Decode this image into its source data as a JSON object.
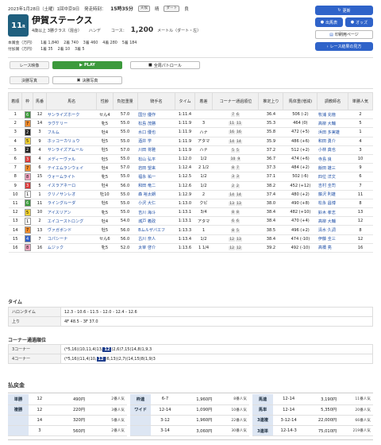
{
  "header": {
    "date": "2023年1月28日（土曜）1回中京9日",
    "start": "発走時刻：",
    "start_time": "15時35分",
    "tags": [
      "天候",
      "晴",
      "ダート",
      "良"
    ]
  },
  "race": {
    "num": "11",
    "r": "R",
    "name": "伊賀ステークス",
    "cond1": "4歳以上 3勝クラス（混合）",
    "cond2": "ハンデ",
    "course_label": "コース：",
    "distance": "1,200",
    "unit": "メートル（ダート・左）"
  },
  "prize": {
    "label1": "本賞金（万円）",
    "label2": "付加賞（万円）",
    "row1": [
      "1着 1,840",
      "2着 740",
      "3着 460",
      "4着 280",
      "5着 184"
    ],
    "row2": [
      "1着 35",
      "2着 10",
      "3着 5"
    ]
  },
  "side": {
    "update": "更新",
    "ichiba": "出馬表",
    "odds": "オッズ",
    "print": "印刷用ページ",
    "other": "レース結果の見方"
  },
  "media": {
    "video_label": "レース映像",
    "play": "PLAY",
    "patrol": "全周パトロール",
    "photo_label": "決勝写真",
    "photo_btn": "決勝写真"
  },
  "table": {
    "headers": [
      "着順",
      "枠",
      "馬番",
      "馬名",
      "性齢",
      "負担重量",
      "騎手名",
      "タイム",
      "着差",
      "コーナー通過順位",
      "推定上り",
      "馬体重(増減)",
      "調教師名",
      "単勝人気"
    ],
    "rows": [
      [
        "1",
        "6",
        "12",
        "サンライズホーク",
        "セん4",
        "57.0",
        "国分 優作",
        "1:11.4",
        "",
        "7 6",
        "36.4",
        "506 (-2)",
        "牧浦 充徳",
        "2"
      ],
      [
        "2",
        "7",
        "14",
        "ラヴケリー",
        "牝5",
        "55.0",
        "松島 茂勝",
        "1:11.9",
        "3",
        "11 11",
        "35.3",
        "464 (0)",
        "高柳 大輔",
        "5"
      ],
      [
        "3",
        "2",
        "3",
        "フルム",
        "牡4",
        "55.0",
        "水口 優也",
        "1:11.9",
        "ハナ",
        "16 16",
        "35.8",
        "472 (+5)",
        "浜田 多実雄",
        "1"
      ],
      [
        "4",
        "5",
        "9",
        "ホッコーカリュウ",
        "牡5",
        "55.0",
        "酒井 学",
        "1:11.9",
        "アタマ",
        "14 14",
        "35.9",
        "486 (+6)",
        "和田 勇介",
        "4"
      ],
      [
        "5",
        "2",
        "4",
        "サンライズアムール",
        "牡5",
        "57.0",
        "川田 将雅",
        "1:11.9",
        "ハナ",
        "5 5",
        "37.2",
        "512 (+2)",
        "小林 真也",
        "3"
      ],
      [
        "6",
        "3",
        "4",
        "メディーヴァル",
        "牡5",
        "55.0",
        "松山 弘平",
        "1:12.0",
        "1/2",
        "10 9",
        "36.7",
        "474 (+6)",
        "寺島 良",
        "10"
      ],
      [
        "7",
        "7",
        "6",
        "テイエムランウェイ",
        "牡4",
        "57.0",
        "岩田 望来",
        "1:12.4",
        "2 1/2",
        "8 7",
        "37.3",
        "484 (+2)",
        "飯田 雄三",
        "9"
      ],
      [
        "8",
        "8",
        "15",
        "ウォームライト",
        "牝5",
        "55.0",
        "福永 祐一",
        "1:12.5",
        "1/2",
        "3 3",
        "37.1",
        "502 (-6)",
        "四位 洋文",
        "6"
      ],
      [
        "9",
        "3",
        "5",
        "イスラアネーロ",
        "牡4",
        "56.0",
        "和田 竜二",
        "1:12.6",
        "1/2",
        "2 2",
        "38.2",
        "452 (+12)",
        "吉村 圭司",
        "7"
      ],
      [
        "10",
        "1",
        "1",
        "クリノサンレオ",
        "牡10",
        "55.0",
        "森 裕太朗",
        "1:12.9",
        "2",
        "14 14",
        "37.4",
        "480 (+2)",
        "藤沢 則雄",
        "11"
      ],
      [
        "11",
        "6",
        "11",
        "ライングルーダ",
        "牡6",
        "55.0",
        "小沢 大仁",
        "1:13.0",
        "クビ",
        "13 13",
        "38.0",
        "490 (+8)",
        "松永 昌博",
        "8"
      ],
      [
        "12",
        "5",
        "10",
        "アイスリアン",
        "牝5",
        "55.0",
        "吉川 海斗",
        "1:13.1",
        "3/4",
        "8 8",
        "38.4",
        "482 (+10)",
        "鈴木 孝志",
        "13"
      ],
      [
        "13",
        "1",
        "2",
        "エイユーストロング",
        "牡4",
        "54.0",
        "城戸 義政",
        "1:13.1",
        "アタマ",
        "6 6",
        "38.4",
        "470 (+4)",
        "高柳 大輔",
        "12"
      ],
      [
        "14",
        "7",
        "13",
        "ヴァガボンド",
        "牡5",
        "56.0",
        "Bムルザバエフ",
        "1:13.3",
        "1",
        "8 5",
        "38.5",
        "496 (+2)",
        "清水 久詞",
        "8"
      ],
      [
        "15",
        "4",
        "7",
        "コパシーナ",
        "セん6",
        "56.0",
        "古川 奈人",
        "1:13.4",
        "1/2",
        "12 13",
        "38.4",
        "474 (-10)",
        "伊藤 圭三",
        "12"
      ],
      [
        "16",
        "8",
        "16",
        "ムジック",
        "牝5",
        "52.0",
        "太宰 啓介",
        "1:13.6",
        "1 1/4",
        "12 12",
        "39.2",
        "492 (-10)",
        "高橋 亮",
        "16"
      ]
    ]
  },
  "time": {
    "title": "タイム",
    "h1": "ハロンタイム",
    "v1": "12.3 - 10.6 - 11.5 - 12.0 - 12.4 - 12.6",
    "h2": "上り",
    "v2": "4F 48.5 - 3F 37.0"
  },
  "corner": {
    "title": "コーナー通過順位",
    "h1": "3コーナー",
    "v1a": "(*5,16)(10,11,4)13,",
    "v1b": "12",
    "v1c": "(2,6)7,15(14,8)1,9,3",
    "h2": "4コーナー",
    "v2a": "(*5,16)(11,4)10,",
    "v2b": "12",
    "v2c": "(6,13)(2,7)(14,15)8(1,9)3"
  },
  "pay": {
    "title": "払戻金",
    "col1": [
      [
        "単勝",
        "12",
        "490円",
        "2番人気"
      ],
      [
        "複勝",
        "12",
        "220円",
        "3番人気"
      ],
      [
        "",
        "14",
        "320円",
        "5番人気"
      ],
      [
        "",
        "3",
        "560円",
        "2番人気"
      ]
    ],
    "col2": [
      [
        "枠連",
        "6-7",
        "1,960円",
        "8番人気"
      ],
      [
        "ワイド",
        "12-14",
        "1,090円",
        "10番人気"
      ],
      [
        "",
        "3-12",
        "1,960円",
        "22番人気"
      ],
      [
        "",
        "3-14",
        "3,060円",
        "30番人気"
      ]
    ],
    "col3": [
      [
        "馬連",
        "12-14",
        "3,190円",
        "11番人気"
      ],
      [
        "馬単",
        "12-14",
        "5,350円",
        "20番人気"
      ],
      [
        "3連複",
        "3-12-14",
        "22,000円",
        "66番人気"
      ],
      [
        "3連単",
        "12-14-3",
        "75,010円",
        "219番人気"
      ]
    ]
  },
  "colors": {
    "accent": "#2f63c9",
    "race_badge": "#1f5f7e",
    "waku": {
      "1": "#ffffff",
      "2": "#222222",
      "3": "#d93a3a",
      "4": "#2f5fc9",
      "5": "#f2d230",
      "6": "#3a9a3a",
      "7": "#f08b2a",
      "8": "#f2a3c0"
    }
  }
}
